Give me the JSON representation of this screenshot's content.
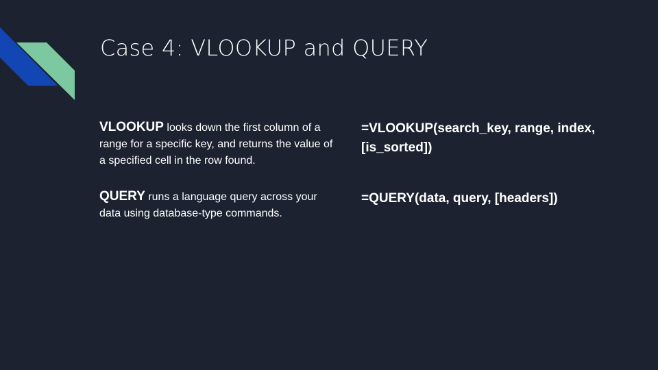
{
  "slide": {
    "title": "Case 4: VLOOKUP and QUERY",
    "colors": {
      "background": "#1c2230",
      "accent_blue": "#1146b4",
      "accent_green": "#7cc8a0",
      "text": "#ffffff"
    },
    "descriptions": [
      {
        "term": "VLOOKUP",
        "text": " looks down the first column of a range for a specific key, and returns the value of a specified cell in the row found."
      },
      {
        "term": "QUERY",
        "text": " runs a language query across your data using database-type commands."
      }
    ],
    "formulas": [
      "=VLOOKUP(search_key, range, index, [is_sorted])",
      "=QUERY(data, query, [headers])"
    ]
  }
}
